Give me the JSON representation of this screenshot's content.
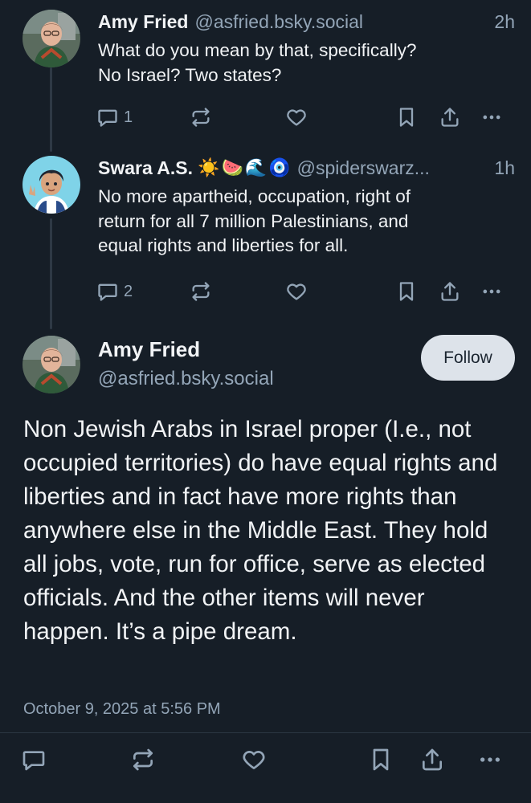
{
  "posts": [
    {
      "display_name": "Amy Fried",
      "handle": "@asfried.bsky.social",
      "time": "2h",
      "text": "What do you mean by that, specifically?\nNo Israel? Two states?",
      "reply_count": "1"
    },
    {
      "display_name": "Swara A.S.",
      "name_emojis": [
        "☀️",
        "🍉",
        "🌊",
        "🧿"
      ],
      "handle": "@spiderswarz...",
      "time": "1h",
      "text": "No more apartheid, occupation, right of\nreturn for all 7 million Palestinians, and\nequal rights and liberties for all.",
      "reply_count": "2"
    }
  ],
  "main_post": {
    "display_name": "Amy Fried",
    "handle": "@asfried.bsky.social",
    "follow_label": "Follow",
    "text": "Non Jewish Arabs in Israel proper (I.e., not occupied territories) do have equal rights and liberties and in fact have more rights than anywhere else in the Middle East. They hold all jobs, vote, run for office, serve as elected officials. And the other items will never happen. It’s a pipe dream.",
    "date": "October 9, 2025 at 5:56 PM"
  },
  "icons": {
    "reply": "speech-bubble-icon",
    "repost": "repost-arrows-icon",
    "like": "heart-outline-icon",
    "bookmark": "bookmark-icon",
    "share": "share-upload-icon",
    "more": "ellipsis-icon"
  },
  "colors": {
    "background": "#161e27",
    "text": "#f1f3f5",
    "muted": "#93a5b7",
    "follow_button": "#dde3ea"
  }
}
